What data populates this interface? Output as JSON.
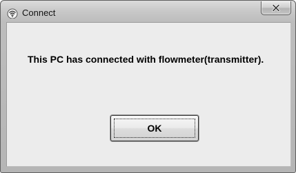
{
  "window": {
    "title": "Connect",
    "icon": "signal-waves-icon",
    "close_glyph": "X"
  },
  "dialog": {
    "message": "This PC has connected with flowmeter(transmitter).",
    "ok_label": "OK"
  },
  "colors": {
    "frame": "#bdbdbd",
    "client_background": "#ececec",
    "text": "#000000"
  }
}
